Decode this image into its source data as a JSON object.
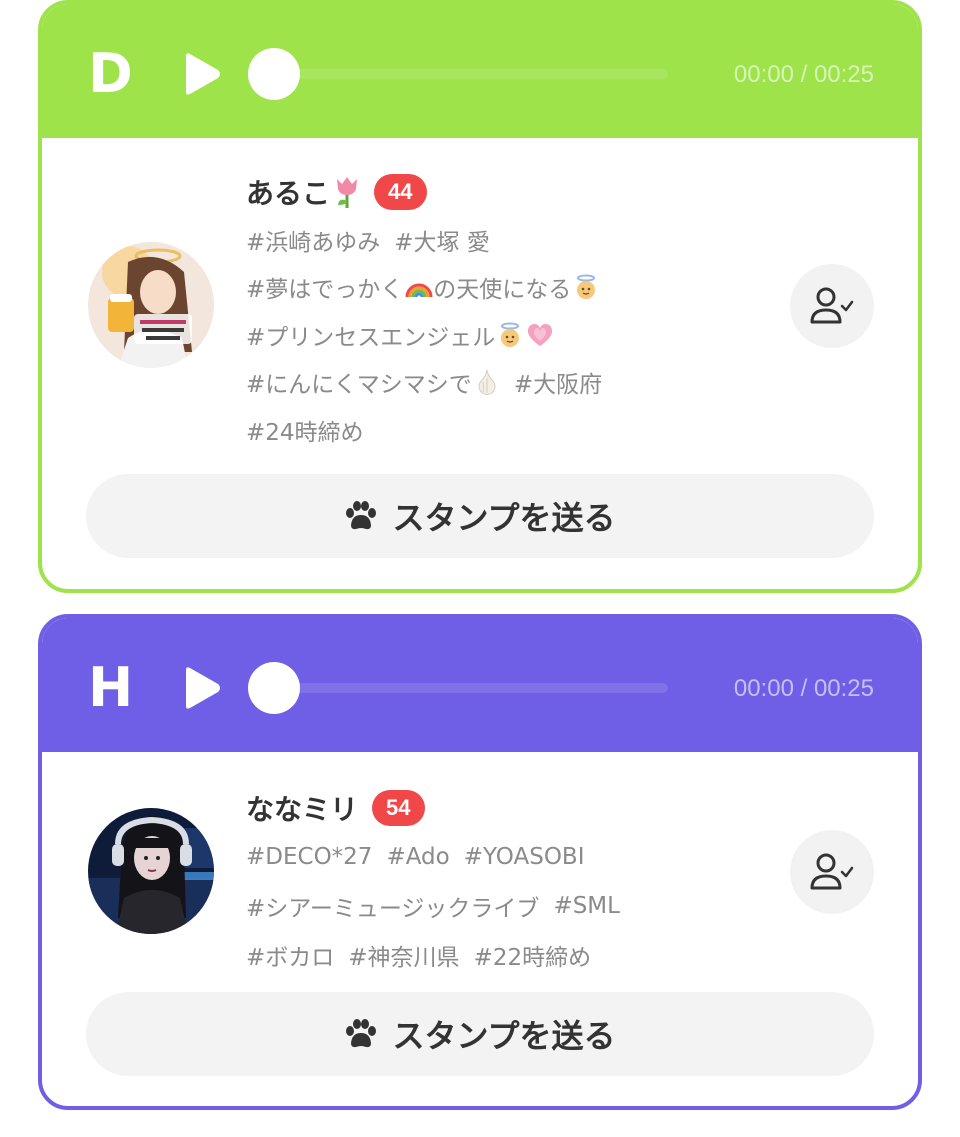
{
  "cards": [
    {
      "accent": "#9ee34a",
      "grade": "D",
      "time": "00:00 / 00:25",
      "progress": 0,
      "name": "あるこ",
      "name_emoji": "tulip-emoji",
      "level": "44",
      "tag_lines": [
        [
          "#浜崎あゆみ",
          "#大塚 愛"
        ],
        [
          "#夢はでっかく",
          "の天使になる"
        ],
        [
          "#プリンセスエンジェル"
        ],
        [
          "#にんにくマシマシで",
          "#大阪府"
        ],
        [
          "#24時締め"
        ]
      ],
      "stamp_label": "スタンプを送る"
    },
    {
      "accent": "#6f5ee6",
      "grade": "H",
      "time": "00:00 / 00:25",
      "progress": 0,
      "name": "ななミリ",
      "level": "54",
      "tag_lines": [
        [
          "#DECO*27",
          "#Ado",
          "#YOASOBI"
        ],
        [
          "#シアーミュージックライブ",
          "#SML"
        ],
        [
          "#ボカロ",
          "#神奈川県",
          "#22時締め"
        ]
      ],
      "stamp_label": "スタンプを送る"
    }
  ],
  "icons": {
    "play": "play-icon",
    "follow": "person-check-icon",
    "stamp": "paw-icon"
  },
  "colors": {
    "level_badge": "#f04848",
    "button_bg": "#f3f3f3",
    "tag_text": "#8a8a8a"
  }
}
